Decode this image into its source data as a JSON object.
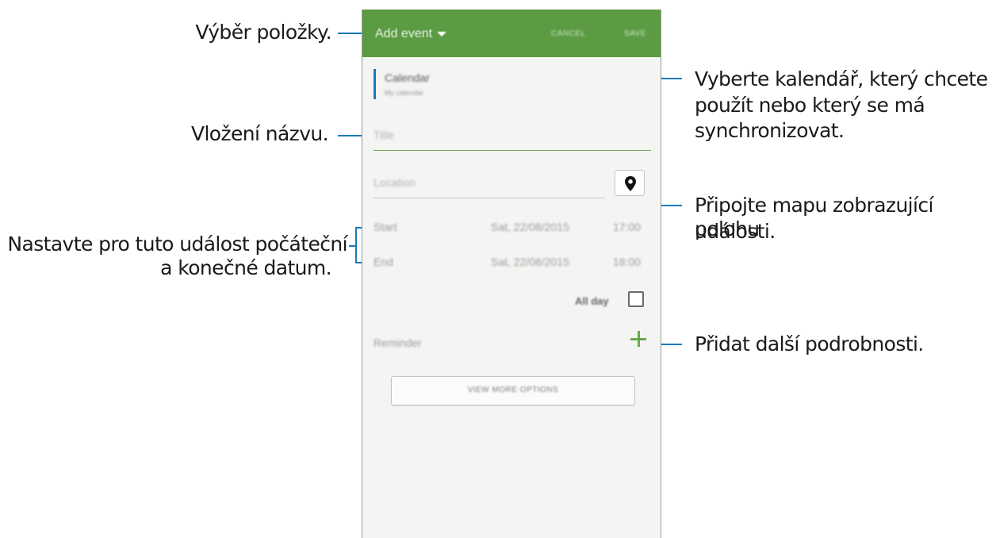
{
  "annotations": {
    "select_item": "Výběr položky.",
    "insert_title": "Vložení názvu.",
    "set_dates_line1": "Nastavte pro tuto událost počáteční",
    "set_dates_line2": "a konečné datum.",
    "choose_calendar_line1": "Vyberte kalendář, který chcete",
    "choose_calendar_line2": "použít nebo který se má",
    "choose_calendar_line3": "synchronizovat.",
    "attach_map_line1": "Připojte mapu zobrazující polohu",
    "attach_map_line2": "události.",
    "add_details": "Přidat další podrobnosti."
  },
  "appbar": {
    "title": "Add event",
    "cancel_label": "CANCEL",
    "save_label": "SAVE"
  },
  "form": {
    "calendar_label": "Calendar",
    "calendar_value": "My calendar",
    "title_placeholder": "Title",
    "location_placeholder": "Location",
    "start_label": "Start",
    "start_date": "Sat, 22/08/2015",
    "start_time": "17:00",
    "end_label": "End",
    "end_date": "Sat, 22/08/2015",
    "end_time": "18:00",
    "allday_label": "All day",
    "allday_checked": false,
    "reminder_label": "Reminder",
    "more_options_label": "VIEW MORE OPTIONS"
  },
  "colors": {
    "appbar": "#5b9b44",
    "accent_green": "#6aa84f",
    "callout_line": "#1a7ab8"
  },
  "icons": [
    "caret-down-icon",
    "location-pin-icon",
    "checkbox-icon",
    "plus-icon"
  ]
}
